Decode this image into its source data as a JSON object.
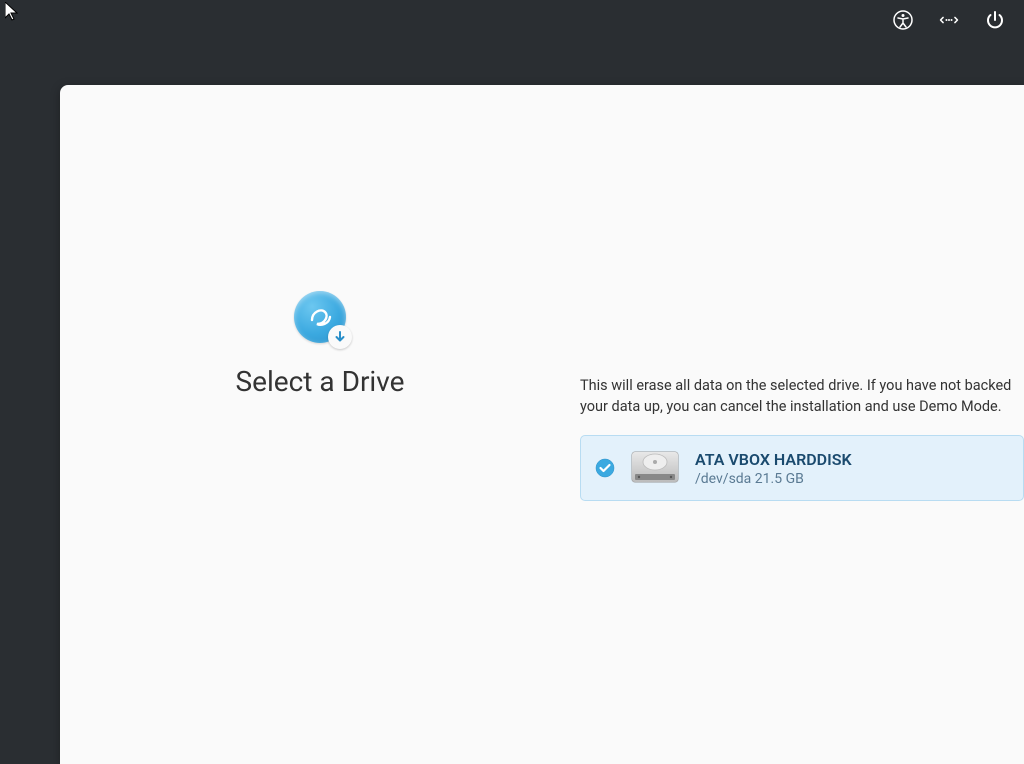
{
  "topbar": {
    "accessibility": "accessibility",
    "network": "network",
    "power": "power"
  },
  "installer": {
    "title": "Select a Drive",
    "warning": "This will erase all data on the selected drive. If you have not backed your data up, you can cancel the installation and use Demo Mode.",
    "drive": {
      "name": "ATA VBOX HARDDISK",
      "path": "/dev/sda",
      "size": "21.5 GB",
      "selected": true
    }
  }
}
